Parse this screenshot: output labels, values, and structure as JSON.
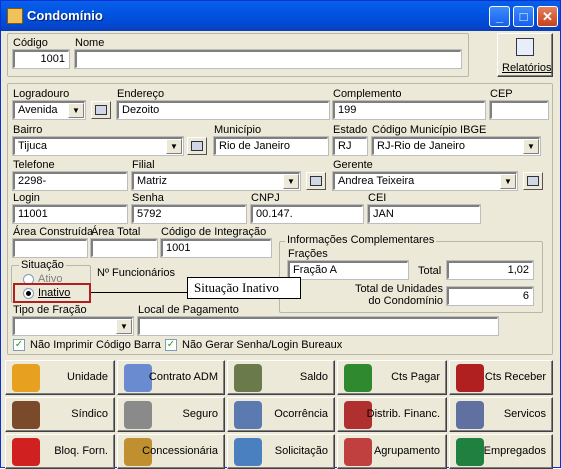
{
  "window": {
    "title": "Condomínio",
    "min_label": "_",
    "max_label": "□",
    "close_label": "✕"
  },
  "header": {
    "codigo_label": "Código",
    "codigo_value": "1001",
    "nome_label": "Nome",
    "nome_value": "",
    "relatorios_label": "Relatórios"
  },
  "address": {
    "logradouro_label": "Logradouro",
    "logradouro_value": "Avenida",
    "endereco_label": "Endereço",
    "endereco_value": "Dezoito",
    "complemento_label": "Complemento",
    "complemento_value": "199",
    "cep_label": "CEP",
    "cep_value": "",
    "bairro_label": "Bairro",
    "bairro_value": "Tijuca",
    "municipio_label": "Município",
    "municipio_value": "Rio de Janeiro",
    "estado_label": "Estado",
    "estado_value": "RJ",
    "ibge_label": "Código Município IBGE",
    "ibge_value": "RJ-Rio de Janeiro"
  },
  "contact": {
    "telefone_label": "Telefone",
    "telefone_value": "2298-",
    "filial_label": "Filial",
    "filial_value": "Matriz",
    "gerente_label": "Gerente",
    "gerente_value": "Andrea Teixeira",
    "login_label": "Login",
    "login_value": "11001",
    "senha_label": "Senha",
    "senha_value": "5792",
    "cnpj_label": "CNPJ",
    "cnpj_value": "00.147.",
    "cei_label": "CEI",
    "cei_value": "JAN"
  },
  "areas": {
    "construida_label": "Área Construída",
    "construida_value": "",
    "total_label": "Área Total",
    "total_value": "",
    "integracao_label": "Código de Integração",
    "integracao_value": "1001"
  },
  "info": {
    "group_label": "Informações Complementares",
    "fracoes_label": "Frações",
    "fracao_value": "Fração A",
    "total_label": "Total",
    "total_value": "1,02",
    "unidades_label": "Total de Unidades do Condomínio",
    "unidades_value": "6"
  },
  "situacao": {
    "group_label": "Situação",
    "ativo_label": "Ativo",
    "inativo_label": "Inativo",
    "funcionarios_label": "Nº Funcionários",
    "funcionarios_value": "",
    "callout_text": "Situação Inativo"
  },
  "fracao": {
    "tipo_label": "Tipo de Fração",
    "tipo_value": "",
    "local_label": "Local de Pagamento",
    "local_value": ""
  },
  "checks": {
    "nao_imprimir": "Não Imprimir Código Barra",
    "nao_gerar": "Não Gerar Senha/Login Bureaux",
    "mark": "✓"
  },
  "buttons": [
    {
      "label": "Unidade",
      "icon": "person-icon",
      "color": "#e8a020"
    },
    {
      "label": "Contrato ADM",
      "icon": "contract-pen-icon",
      "color": "#6b8bd0"
    },
    {
      "label": "Saldo",
      "icon": "money-bag-icon",
      "color": "#6b7a4a"
    },
    {
      "label": "Cts Pagar",
      "icon": "cash-pay-icon",
      "color": "#2f8a2f"
    },
    {
      "label": "Cts Receber",
      "icon": "cash-receive-icon",
      "color": "#b02020"
    },
    {
      "label": "Síndico",
      "icon": "sindico-face-icon",
      "color": "#7a4a2a"
    },
    {
      "label": "Seguro",
      "icon": "safe-icon",
      "color": "#8a8a8a"
    },
    {
      "label": "Ocorrência",
      "icon": "occurrence-scroll-icon",
      "color": "#5a7ab0"
    },
    {
      "label": "Distrib. Financ.",
      "icon": "distribution-icon",
      "color": "#b03030"
    },
    {
      "label": "Servicos",
      "icon": "services-hands-icon",
      "color": "#6070a0"
    },
    {
      "label": "Bloq. Forn.",
      "icon": "block-icon",
      "color": "#d02020"
    },
    {
      "label": "Concessionária",
      "icon": "tools-icon",
      "color": "#c09030"
    },
    {
      "label": "Solicitação",
      "icon": "request-icon",
      "color": "#4a80c0"
    },
    {
      "label": "Agrupamento",
      "icon": "group-icon",
      "color": "#c04040"
    },
    {
      "label": "Empregados",
      "icon": "employee-icon",
      "color": "#208040"
    }
  ]
}
